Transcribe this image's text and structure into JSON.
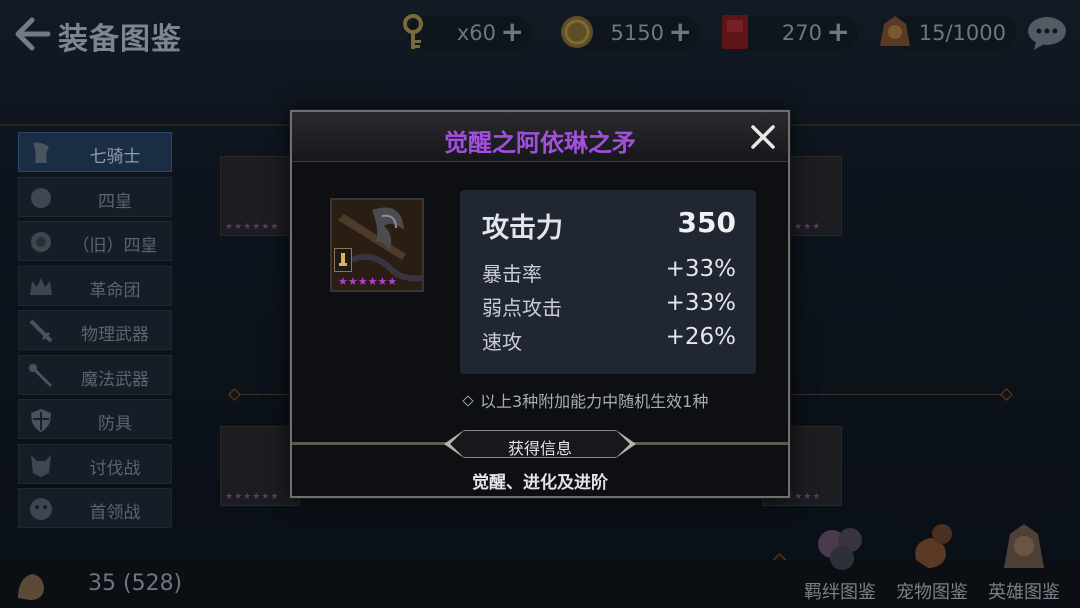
{
  "header": {
    "title": "装备图鉴",
    "resources": [
      {
        "icon": "key-icon",
        "value": "x60"
      },
      {
        "icon": "coin-icon",
        "value": "5150"
      },
      {
        "icon": "ruby-icon",
        "value": "270"
      },
      {
        "icon": "hero-capacity-icon",
        "value": "15/1000"
      }
    ]
  },
  "sidebar": {
    "items": [
      {
        "label": "七骑士",
        "icon": "knight-emblem-icon",
        "active": true
      },
      {
        "label": "四皇",
        "icon": "four-emperors-icon"
      },
      {
        "label": "（旧）四皇",
        "icon": "old-four-emperors-icon"
      },
      {
        "label": "革命团",
        "icon": "crown-icon"
      },
      {
        "label": "物理武器",
        "icon": "sword-icon"
      },
      {
        "label": "魔法武器",
        "icon": "staff-icon"
      },
      {
        "label": "防具",
        "icon": "shield-icon"
      },
      {
        "label": "讨伐战",
        "icon": "demon-icon"
      },
      {
        "label": "首领战",
        "icon": "boss-icon"
      }
    ]
  },
  "footer": {
    "count": "35 (528)",
    "tabs": [
      {
        "label": "羁绊图鉴",
        "icon": "bond-collection-icon"
      },
      {
        "label": "宠物图鉴",
        "icon": "pet-collection-icon"
      },
      {
        "label": "英雄图鉴",
        "icon": "hero-collection-icon"
      }
    ]
  },
  "modal": {
    "title": "觉醒之阿依琳之矛",
    "title_color": "#a24fe0",
    "item_stars": "★★★★★★",
    "main_stat": {
      "label": "攻击力",
      "value": "350"
    },
    "stats": [
      {
        "label": "暴击率",
        "value": "+33%"
      },
      {
        "label": "弱点攻击",
        "value": "+33%"
      },
      {
        "label": "速攻",
        "value": "+26%"
      }
    ],
    "note": "以上3种附加能力中随机生效1种",
    "source_label": "获得信息",
    "source_text": "觉醒、进化及进阶"
  }
}
